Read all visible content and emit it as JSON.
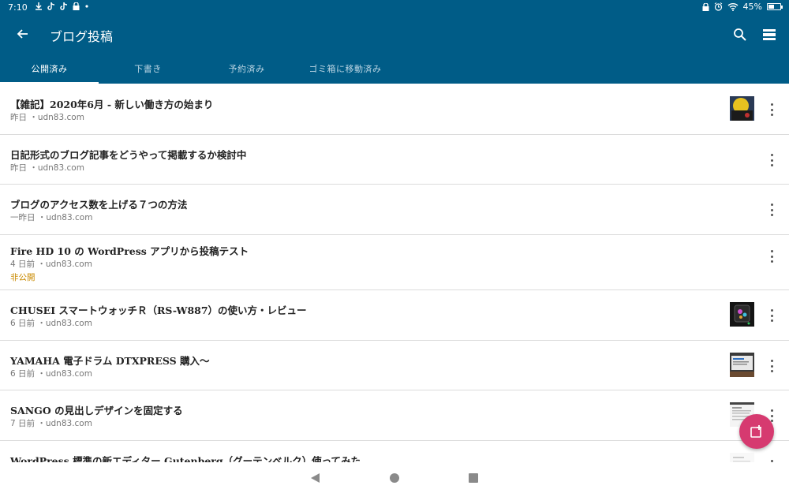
{
  "status_bar": {
    "time": "7:10",
    "battery_text": "45%",
    "battery_level": 0.45,
    "left_icons": [
      "download-icon",
      "tiktok-icon",
      "tiktok-icon",
      "lock-icon",
      "dot-icon"
    ],
    "right_icons": [
      "lock-icon",
      "alarm-icon",
      "wifi-icon",
      "battery-icon"
    ]
  },
  "app_bar": {
    "title": "ブログ投稿",
    "back_icon": "arrow-left-icon",
    "search_icon": "search-icon",
    "view_icon": "view-toggle-icon",
    "background": "#005c87"
  },
  "tabs": [
    {
      "label": "公開済み",
      "active": true
    },
    {
      "label": "下書き",
      "active": false
    },
    {
      "label": "予約済み",
      "active": false
    },
    {
      "label": "ゴミ箱に移動済み",
      "active": false
    }
  ],
  "posts": [
    {
      "title": "【雑記】2020年6月 - 新しい働き方の始まり",
      "meta": "昨日 ・udn83.com",
      "status": "",
      "thumbnail": "yellow-photo"
    },
    {
      "title": "日記形式のブログ記事をどうやって掲載するか検討中",
      "meta": "昨日 ・udn83.com",
      "status": "",
      "thumbnail": ""
    },
    {
      "title": "ブログのアクセス数を上げる７つの方法",
      "meta": "一昨日 ・udn83.com",
      "status": "",
      "thumbnail": ""
    },
    {
      "title": "Fire HD 10 の WordPress アプリから投稿テスト",
      "meta": "4 日前 ・udn83.com",
      "status": "非公開",
      "thumbnail": ""
    },
    {
      "title": "CHUSEI スマートウォッチＲ（RS-W887）の使い方・レビュー",
      "meta": "6 日前 ・udn83.com",
      "status": "",
      "thumbnail": "watch-photo"
    },
    {
      "title": "YAMAHA 電子ドラム DTXPRESS 購入〜",
      "meta": "6 日前 ・udn83.com",
      "status": "",
      "thumbnail": "screen-photo"
    },
    {
      "title": "SANGO の見出しデザインを固定する",
      "meta": "7 日前 ・udn83.com",
      "status": "",
      "thumbnail": "doc-photo"
    },
    {
      "title": "WordPress 標準の新エディター Gutenberg（グーテンベルク）使ってみた",
      "meta": "",
      "status": "",
      "thumbnail": "doc-photo-light"
    }
  ],
  "fab": {
    "icon": "new-post-icon",
    "color": "#d63a70"
  },
  "nav_bar": {
    "icons": [
      "nav-back-icon",
      "nav-home-icon",
      "nav-recents-icon"
    ]
  }
}
